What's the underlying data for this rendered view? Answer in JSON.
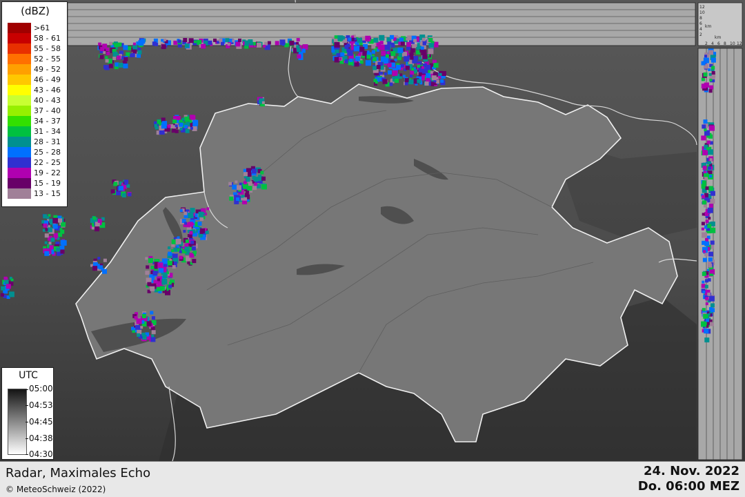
{
  "map": {
    "title": "Radar, Maximales Echo",
    "copyright": "© MeteoSchweiz (2022)",
    "date": "24. Nov. 2022",
    "time": "Do. 06:00 MEZ"
  },
  "legend": {
    "unit": "(dBZ)",
    "classes": [
      {
        "label": ">61",
        "color": "#a00000"
      },
      {
        "label": "58 - 61",
        "color": "#c80000"
      },
      {
        "label": "55 - 58",
        "color": "#e83000"
      },
      {
        "label": "52 - 55",
        "color": "#ff7000"
      },
      {
        "label": "49 - 52",
        "color": "#ffa000"
      },
      {
        "label": "46 - 49",
        "color": "#ffc800"
      },
      {
        "label": "43 - 46",
        "color": "#ffff00"
      },
      {
        "label": "40 - 43",
        "color": "#c8ff32"
      },
      {
        "label": "37 - 40",
        "color": "#96f000"
      },
      {
        "label": "34 - 37",
        "color": "#32e000"
      },
      {
        "label": "31 - 34",
        "color": "#00c040"
      },
      {
        "label": "28 - 31",
        "color": "#009090"
      },
      {
        "label": "25 - 28",
        "color": "#0070ff"
      },
      {
        "label": "22 - 25",
        "color": "#3030d0"
      },
      {
        "label": "19 - 22",
        "color": "#b000b0"
      },
      {
        "label": "15 - 19",
        "color": "#680068"
      },
      {
        "label": "13 - 15",
        "color": "#a08098"
      }
    ]
  },
  "utc_scale": {
    "title": "UTC",
    "labels": [
      "05:00",
      "04:53",
      "04:45",
      "04:38",
      "04:30"
    ]
  },
  "profile": {
    "height_unit": "km",
    "height_ticks": [
      "12",
      "10",
      "8",
      "6",
      "4",
      "2"
    ],
    "width_ticks": [
      "2",
      "4",
      "6",
      "8",
      "10",
      "12"
    ]
  }
}
